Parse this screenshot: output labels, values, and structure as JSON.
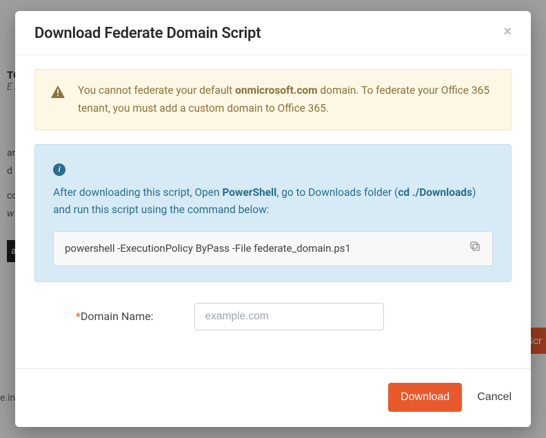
{
  "background": {
    "header": "TO",
    "sub": "E AL",
    "text1": "are",
    "text2": "d a",
    "text3": "con",
    "text4": "w N",
    "darkBtn": "a D",
    "orangeBtn": "Scr",
    "bottom": "e.in"
  },
  "modal": {
    "title": "Download Federate Domain Script",
    "closeGlyph": "×",
    "warning": {
      "before": "You cannot federate your default ",
      "bold": "onmicrosoft.com",
      "after": " domain. To federate your Office 365 tenant, you must add a custom domain to Office 365."
    },
    "info": {
      "iconGlyph": "i",
      "p1_before": "After downloading this script, Open ",
      "p1_b1": "PowerShell",
      "p1_mid": ", go to Downloads folder (",
      "p1_b2": "cd ./Downloads",
      "p1_after": ") and run this script using the command below:",
      "command": "powershell -ExecutionPolicy ByPass -File federate_domain.ps1"
    },
    "form": {
      "label": "Domain Name:",
      "placeholder": "example.com"
    },
    "footer": {
      "download": "Download",
      "cancel": "Cancel"
    }
  }
}
